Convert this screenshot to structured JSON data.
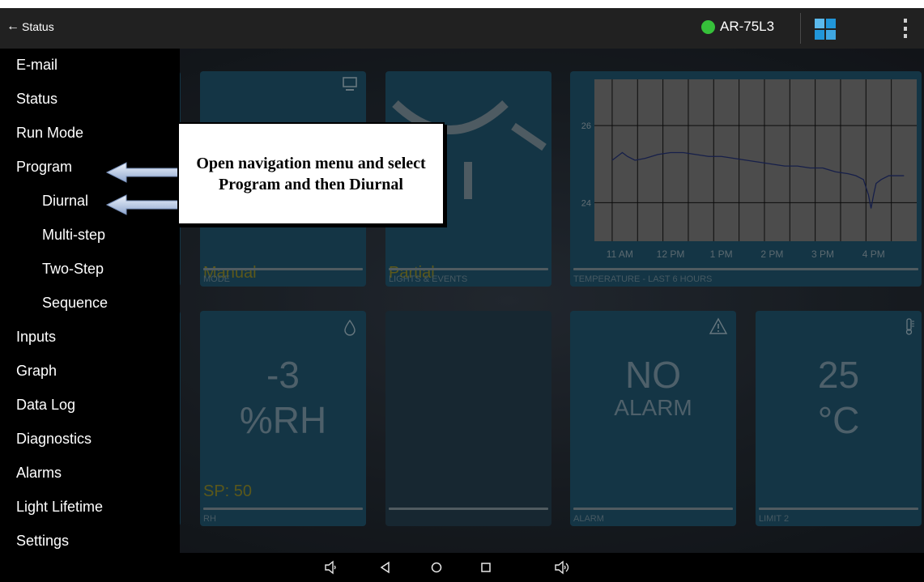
{
  "actionbar": {
    "back_label": "Status",
    "device_name": "AR-75L3",
    "status_color": "#36c13a"
  },
  "drawer": {
    "items": [
      {
        "label": "E-mail"
      },
      {
        "label": "Status"
      },
      {
        "label": "Run Mode"
      },
      {
        "label": "Program"
      },
      {
        "label": "Diurnal"
      },
      {
        "label": "Multi-step"
      },
      {
        "label": "Two-Step"
      },
      {
        "label": "Sequence"
      },
      {
        "label": "Inputs"
      },
      {
        "label": "Graph"
      },
      {
        "label": "Data Log"
      },
      {
        "label": "Diagnostics"
      },
      {
        "label": "Alarms"
      },
      {
        "label": "Light Lifetime"
      },
      {
        "label": "Settings"
      }
    ]
  },
  "callout": {
    "text": "Open navigation menu and select Program and then Diurnal"
  },
  "tiles": {
    "mode": {
      "value": "Manual",
      "caption": "MODE",
      "icon": "monitor-icon"
    },
    "lights": {
      "value": "Partial",
      "caption": "LIGHTS & EVENTS",
      "icon": "lamp-icon"
    },
    "temperature_chart": {
      "caption": "TEMPERATURE - LAST 6 HOURS"
    },
    "rh": {
      "value": "-3",
      "unit": "%RH",
      "setpoint": "SP: 50",
      "caption": "RH",
      "icon": "droplet-icon"
    },
    "alarm": {
      "value": "NO",
      "sub": "ALARM",
      "caption": "ALARM",
      "icon": "warning-icon"
    },
    "limit": {
      "value": "25",
      "unit": "°C",
      "caption": "LIMIT 2",
      "icon": "thermometer-icon"
    }
  },
  "chart_data": {
    "type": "line",
    "title": "",
    "xlabel": "",
    "ylabel": "",
    "x_ticks": [
      "11 AM",
      "12 PM",
      "1 PM",
      "2 PM",
      "3 PM",
      "4 PM"
    ],
    "y_ticks": [
      26,
      24
    ],
    "ylim": [
      23.0,
      27.2
    ],
    "grid": true,
    "series": [
      {
        "x": [
          10.85,
          10.95,
          11.05,
          11.15,
          11.3,
          11.5,
          11.75,
          12.0,
          12.25,
          12.5,
          12.75,
          13.0,
          13.25,
          13.5,
          13.75,
          14.0,
          14.25,
          14.5,
          14.75,
          15.0,
          15.25,
          15.5,
          15.65,
          15.8,
          15.9,
          15.95,
          16.0,
          16.05,
          16.15,
          16.3,
          16.45,
          16.6
        ],
        "y": [
          25.1,
          25.2,
          25.3,
          25.2,
          25.1,
          25.15,
          25.25,
          25.3,
          25.3,
          25.25,
          25.2,
          25.2,
          25.15,
          25.1,
          25.05,
          25.0,
          24.95,
          24.95,
          24.9,
          24.9,
          24.8,
          24.75,
          24.7,
          24.6,
          24.2,
          23.85,
          24.2,
          24.5,
          24.6,
          24.7,
          24.7,
          24.7
        ]
      }
    ]
  },
  "sysnav": {
    "volume_down_icon": "volume-down-icon",
    "back_icon": "back-icon",
    "home_icon": "home-icon",
    "recents_icon": "recents-icon",
    "volume_up_icon": "volume-up-icon"
  }
}
